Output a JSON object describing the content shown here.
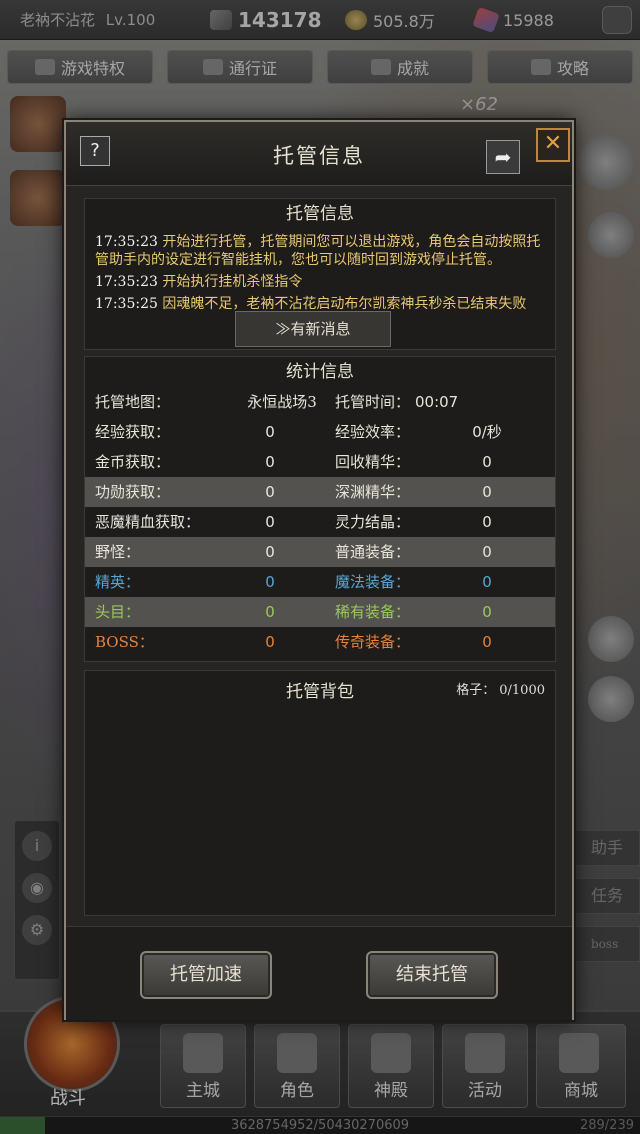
{
  "hud": {
    "player_name": "老衲不沾花",
    "level": "Lv.100",
    "power": "143178",
    "gold": "505.8万",
    "gems": "15988"
  },
  "top_tabs": [
    "游戏特权",
    "通行证",
    "成就",
    "攻略"
  ],
  "multiplier": "×62",
  "modal": {
    "title": "托管信息",
    "help_label": "?",
    "share_label": "➦",
    "close_label": "✕",
    "log": {
      "title": "托管信息",
      "entries": [
        {
          "time": "17:35:23",
          "text": "开始进行托管，托管期间您可以退出游戏，角色会自动按照托管助手内的设定进行智能挂机，您也可以随时回到游戏停止托管。"
        },
        {
          "time": "17:35:23",
          "text": "开始执行挂机杀怪指令"
        },
        {
          "time": "17:35:25",
          "text": "因魂魄不足，老衲不沾花启动布尔凯索神兵秒杀已结束失败"
        }
      ],
      "new_msg_label": "≫有新消息"
    },
    "stats": {
      "title": "统计信息",
      "map_label": "托管地图：",
      "map_value": "永恒战场3",
      "time_label": "托管时间：",
      "time_value": "00:07",
      "rows": [
        {
          "k1": "经验获取：",
          "v1": "0",
          "k2": "经验效率：",
          "v2": "0/秒",
          "color": "c-white",
          "shade": false
        },
        {
          "k1": "金币获取：",
          "v1": "0",
          "k2": "回收精华：",
          "v2": "0",
          "color": "c-white",
          "shade": false
        },
        {
          "k1": "功勋获取：",
          "v1": "0",
          "k2": "深渊精华：",
          "v2": "0",
          "color": "c-white",
          "shade": true
        },
        {
          "k1": "恶魔精血获取：",
          "v1": "0",
          "k2": "灵力结晶：",
          "v2": "0",
          "color": "c-white",
          "shade": false
        },
        {
          "k1": "野怪：",
          "v1": "0",
          "k2": "普通装备：",
          "v2": "0",
          "color": "c-white",
          "shade": true
        },
        {
          "k1": "精英：",
          "v1": "0",
          "k2": "魔法装备：",
          "v2": "0",
          "color": "c-blue",
          "shade": false
        },
        {
          "k1": "头目：",
          "v1": "0",
          "k2": "稀有装备：",
          "v2": "0",
          "color": "c-green",
          "shade": true
        },
        {
          "k1": "BOSS：",
          "v1": "0",
          "k2": "传奇装备：",
          "v2": "0",
          "color": "c-orange",
          "shade": false
        }
      ]
    },
    "bag": {
      "title": "托管背包",
      "capacity_label": "格子：",
      "capacity_value": "0/1000"
    },
    "accelerate_label": "托管加速",
    "end_label": "结束托管"
  },
  "side": {
    "right_peek": [
      "助手",
      "任务",
      "boss"
    ]
  },
  "nav": {
    "battle": "战斗",
    "items": [
      "主城",
      "角色",
      "神殿",
      "活动",
      "商城"
    ]
  },
  "exp_progress": 0.07,
  "exp_text": "3628754952/50430270609",
  "coord_text": "289/239"
}
